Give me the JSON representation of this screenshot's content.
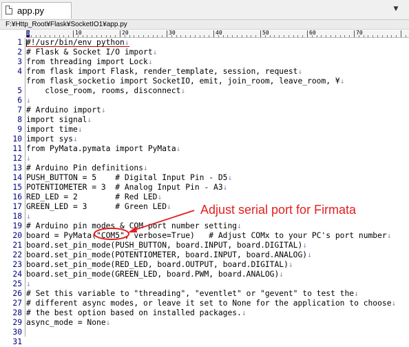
{
  "tab": {
    "title": "app.py"
  },
  "path": "F:¥Http_Root¥Flask¥SocketIO1¥app.py",
  "ruler": {
    "marks": [
      "0",
      "10",
      "20",
      "30",
      "40",
      "50",
      "60",
      "70"
    ]
  },
  "eol_mark": "↓",
  "code_lines": [
    "#!/usr/bin/env python",
    "# Flask & Socket I/O import",
    "from threading import Lock",
    "from flask import Flask, render_template, session, request",
    "from flask_socketio import SocketIO, emit, join_room, leave_room, ¥",
    "    close_room, rooms, disconnect",
    "",
    "# Arduino import",
    "import signal",
    "import time",
    "import sys",
    "from PyMata.pymata import PyMata",
    "",
    "# Arduino Pin definitions",
    "PUSH_BUTTON = 5    # Digital Input Pin - D5",
    "POTENTIOMETER = 3  # Analog Input Pin - A3",
    "RED_LED = 2        # Red LED",
    "GREEN_LED = 3      # Green LED",
    "",
    "# Arduino pin modes & COM port number setting",
    "board = PyMata(\"COM5\", verbose=True)   # Adjust COMx to your PC's port number",
    "board.set_pin_mode(PUSH_BUTTON, board.INPUT, board.DIGITAL)",
    "board.set_pin_mode(POTENTIOMETER, board.INPUT, board.ANALOG)",
    "board.set_pin_mode(RED_LED, board.OUTPUT, board.DIGITAL)",
    "board.set_pin_mode(GREEN_LED, board.PWM, board.ANALOG)",
    "",
    "# Set this variable to \"threading\", \"eventlet\" or \"gevent\" to test the",
    "# different async modes, or leave it set to None for the application to choose",
    "# the best option based on installed packages.",
    "async_mode = None",
    ""
  ],
  "line_numbers": [
    "1",
    "2",
    "3",
    "4",
    "",
    "5",
    "6",
    "7",
    "8",
    "9",
    "10",
    "11",
    "12",
    "13",
    "14",
    "15",
    "16",
    "17",
    "18",
    "19",
    "20",
    "21",
    "22",
    "23",
    "24",
    "25",
    "26",
    "27",
    "28",
    "29",
    "30",
    "31"
  ],
  "annotation": {
    "text": "Adjust serial port for Firmata",
    "color": "#e32020"
  }
}
